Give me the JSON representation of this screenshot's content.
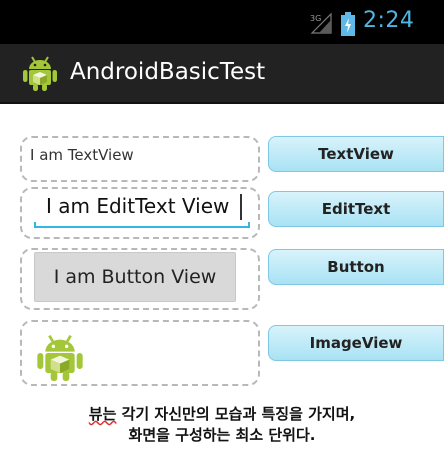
{
  "status_bar": {
    "network": "3G",
    "time": "2:24",
    "time_color": "#4fb5e3"
  },
  "action_bar": {
    "title": "AndroidBasicTest",
    "icon": "android-icon",
    "background": "#222222"
  },
  "views": {
    "text_view": "I am TextView",
    "edit_text": "I am EditText View",
    "button": "I am Button View",
    "image_view_icon": "android-icon"
  },
  "labels": [
    "TextView",
    "EditText",
    "Button",
    "ImageView"
  ],
  "caption": {
    "line1_underlined": "뷰는",
    "line1_rest": " 각기 자신만의 모습과 특징을 가지며,",
    "line2": "화면을 구성하는 최소 단위다."
  },
  "colors": {
    "accent": "#33b5e5",
    "label_gradient_top": "#d8f3fb",
    "label_gradient_bottom": "#a9e2f4",
    "android_green": "#a4c639"
  }
}
